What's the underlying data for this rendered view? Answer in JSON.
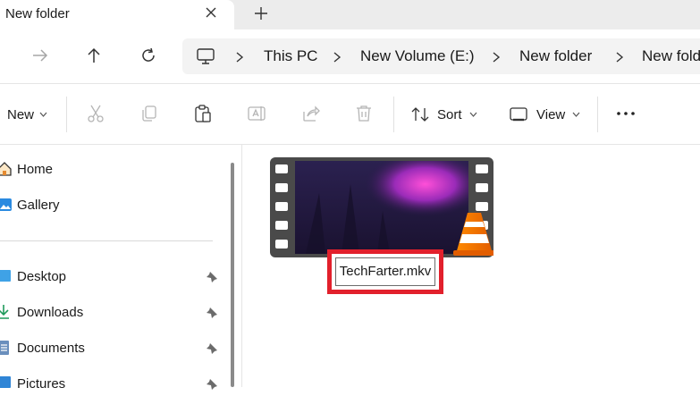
{
  "window": {
    "tab_title": "New folder"
  },
  "address_bar": {
    "items": [
      "This PC",
      "New Volume (E:)",
      "New folder",
      "New folde"
    ]
  },
  "toolbar": {
    "new_label": "New",
    "sort_label": "Sort",
    "view_label": "View"
  },
  "sidebar": {
    "items": [
      {
        "label": "Home",
        "icon": "home-icon"
      },
      {
        "label": "Gallery",
        "icon": "gallery-icon"
      },
      {
        "label": "Desktop",
        "icon": "desktop-icon",
        "pinned": true
      },
      {
        "label": "Downloads",
        "icon": "downloads-icon",
        "pinned": true
      },
      {
        "label": "Documents",
        "icon": "documents-icon",
        "pinned": true
      },
      {
        "label": "Pictures",
        "icon": "pictures-icon",
        "pinned": true
      }
    ]
  },
  "file": {
    "name": "TechFarter.mkv"
  },
  "colors": {
    "highlight": "#e2202c",
    "accent": "#0067c0"
  }
}
